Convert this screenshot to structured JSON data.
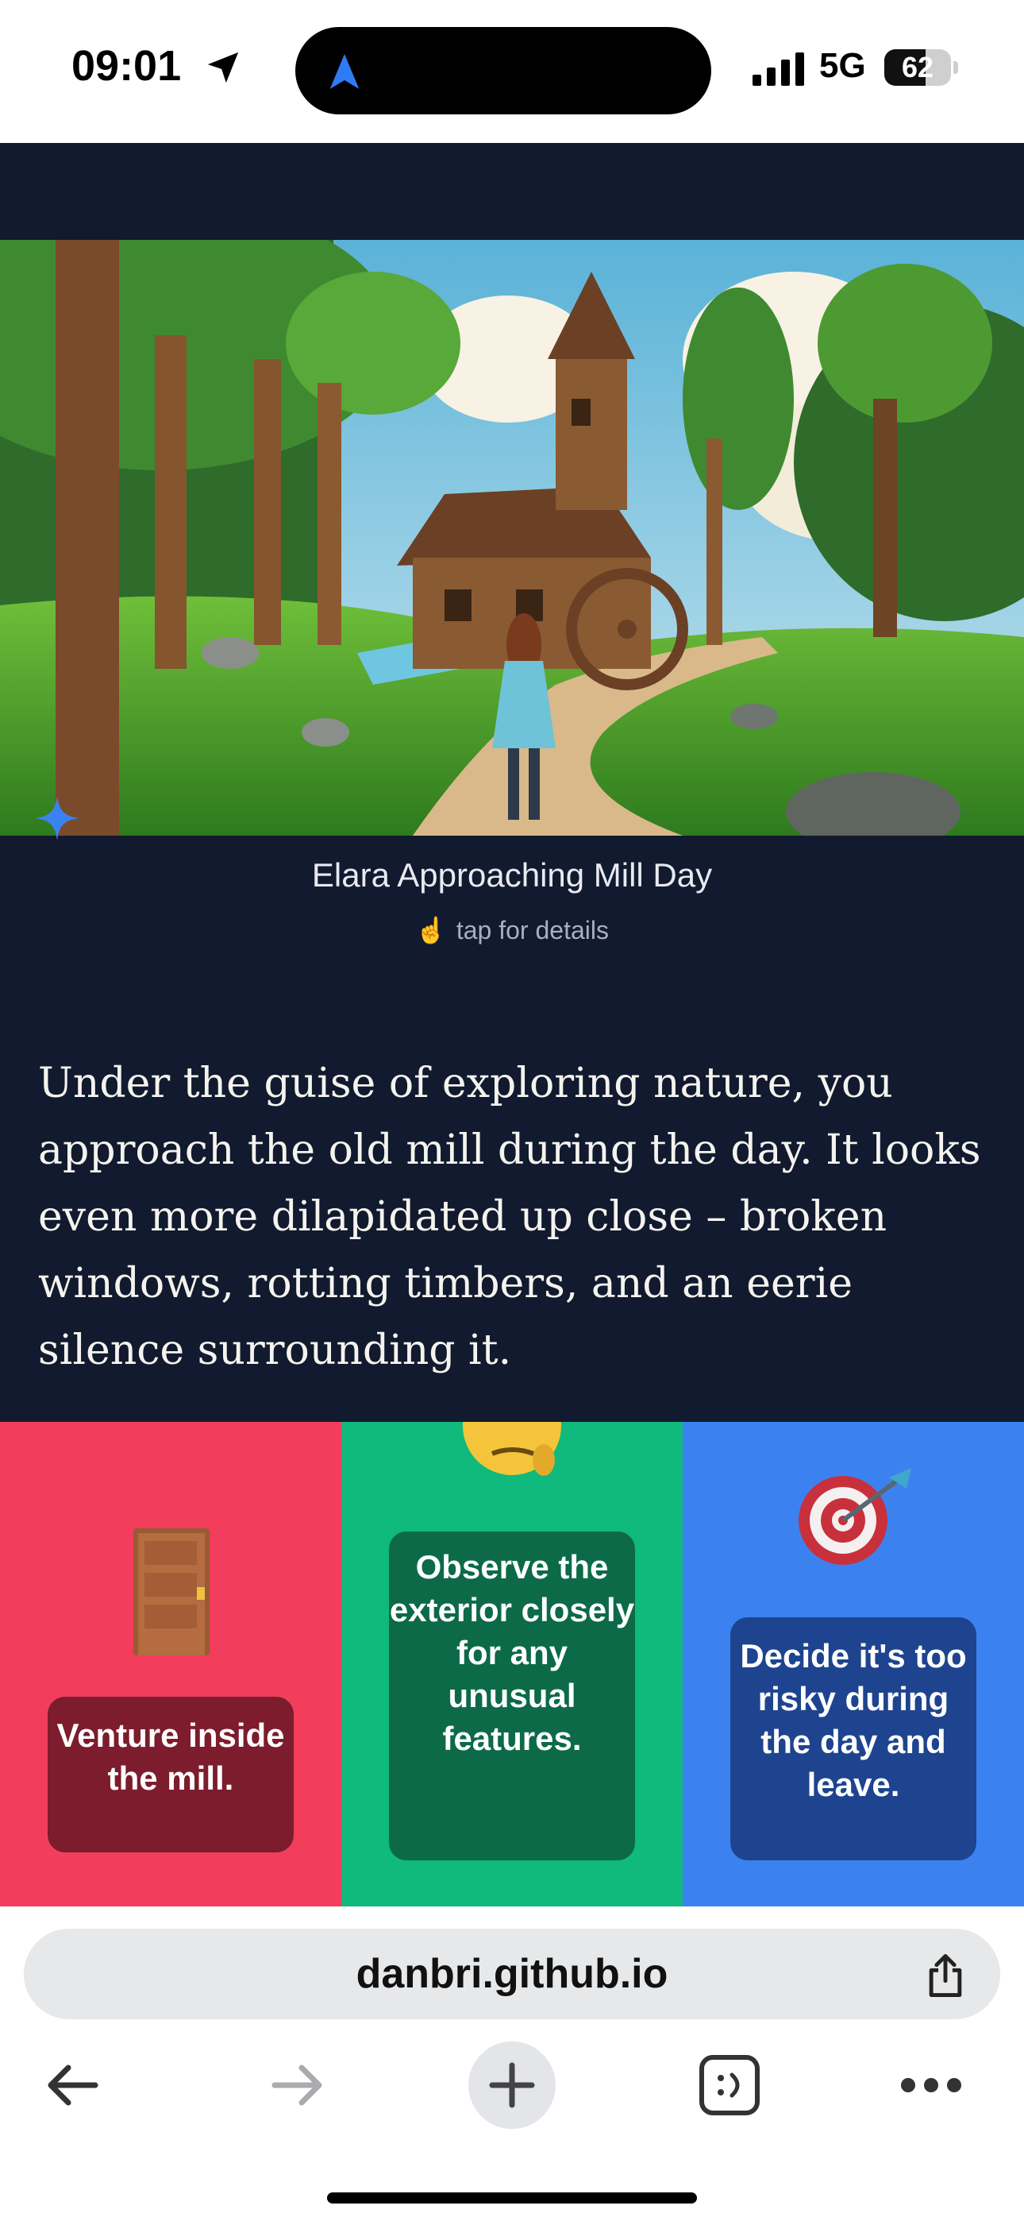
{
  "status_bar": {
    "time": "09:01",
    "network": "5G",
    "battery_level": "62",
    "battery_fraction": 0.62
  },
  "scene": {
    "caption": "Elara Approaching Mill Day",
    "tap_hint": "tap for details",
    "tap_hint_icon": "pointing-hand-icon"
  },
  "story": {
    "text": "Under the guise of exploring nature, you approach the old mill during the day. It looks even more dilapidated up close – broken windows, rotting timbers, and an eerie silence surrounding it."
  },
  "choices": [
    {
      "icon": "door-icon",
      "label": "Venture inside the mill.",
      "color": "#f23d5c"
    },
    {
      "icon": "thinking-face-icon",
      "label": "Observe the exterior closely for any unusual features.",
      "color": "#10b97c"
    },
    {
      "icon": "target-icon",
      "label": "Decide it's too risky during the day and leave.",
      "color": "#3b82f0"
    }
  ],
  "browser": {
    "url": "danbri.github.io"
  },
  "colors": {
    "page_background": "#111a2e",
    "accent_blue": "#2f7bf5"
  }
}
